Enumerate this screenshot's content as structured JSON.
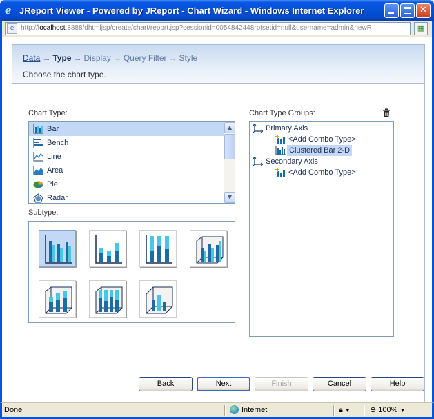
{
  "window": {
    "title": "JReport Viewer - Powered by JReport - Chart Wizard - Windows Internet Explorer",
    "url_host": "localhost",
    "url_prefix": "http://",
    "url_rest": ":8888/dhtmljsp/create/chart/report.jsp?sessionid=0054842448rptsetid=null&username=admin&newR"
  },
  "wizard": {
    "steps": [
      {
        "label": "Data",
        "state": "link"
      },
      {
        "label": "Type",
        "state": "current"
      },
      {
        "label": "Display",
        "state": "pending"
      },
      {
        "label": "Query Filter",
        "state": "pending"
      },
      {
        "label": "Style",
        "state": "pending"
      }
    ],
    "instruction": "Choose the chart type."
  },
  "chart_type": {
    "label": "Chart Type:",
    "items": [
      {
        "label": "Bar",
        "icon": "bar-chart-icon",
        "selected": true
      },
      {
        "label": "Bench",
        "icon": "bench-chart-icon",
        "selected": false
      },
      {
        "label": "Line",
        "icon": "line-chart-icon",
        "selected": false
      },
      {
        "label": "Area",
        "icon": "area-chart-icon",
        "selected": false
      },
      {
        "label": "Pie",
        "icon": "pie-chart-icon",
        "selected": false
      },
      {
        "label": "Radar",
        "icon": "radar-chart-icon",
        "selected": false
      }
    ]
  },
  "subtype": {
    "label": "Subtype:",
    "items": [
      {
        "icon": "clustered-bar-2d-icon",
        "selected": true
      },
      {
        "icon": "stacked-bar-2d-icon",
        "selected": false
      },
      {
        "icon": "percent-stacked-bar-2d-icon",
        "selected": false
      },
      {
        "icon": "clustered-bar-3d-icon",
        "selected": false
      },
      {
        "icon": "stacked-bar-3d-icon",
        "selected": false
      },
      {
        "icon": "percent-stacked-bar-3d-icon",
        "selected": false
      },
      {
        "icon": "deep-bar-3d-icon",
        "selected": false
      }
    ]
  },
  "groups": {
    "label": "Chart Type Groups:",
    "primary_axis": "Primary Axis",
    "primary_add": "<Add Combo Type>",
    "primary_item": "Clustered Bar 2-D",
    "secondary_axis": "Secondary Axis",
    "secondary_add": "<Add Combo Type>"
  },
  "buttons": {
    "back": "Back",
    "next": "Next",
    "finish": "Finish",
    "cancel": "Cancel",
    "help": "Help"
  },
  "status": {
    "text": "Done",
    "zone": "Internet",
    "zoom": "100%"
  },
  "colors": {
    "bar_light": "#49c6e5",
    "bar_dark": "#1f6a9e",
    "selection": "#c2d8f5",
    "titlebar": "#0453d8"
  }
}
